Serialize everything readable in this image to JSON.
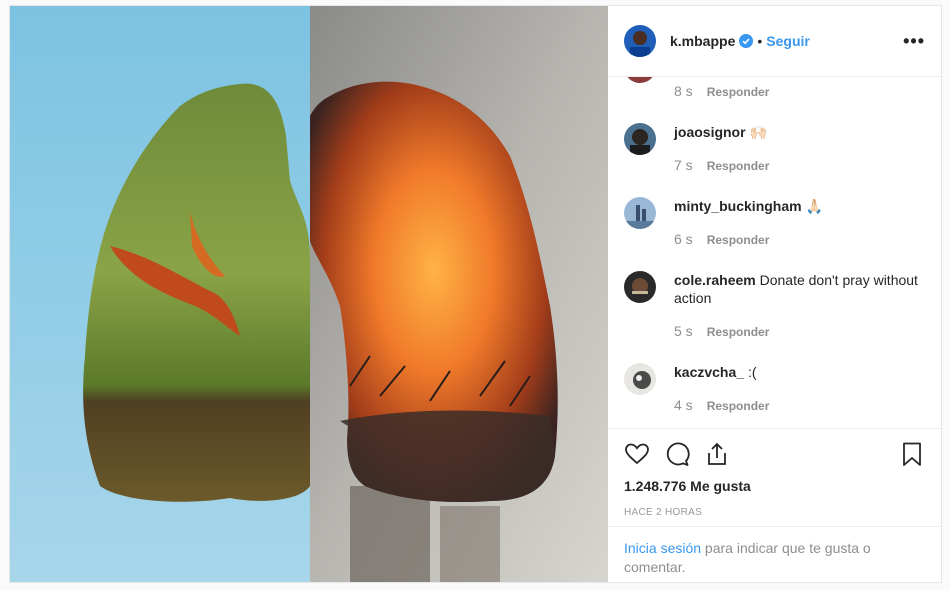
{
  "post": {
    "author": "k.mbappe",
    "follow_label": "Seguir",
    "separator": "•",
    "more_label": "•••"
  },
  "comments": [
    {
      "user": "",
      "text": "",
      "time": "8 s",
      "reply": "Responder"
    },
    {
      "user": "joaosignor",
      "text": "🙌🏻",
      "time": "7 s",
      "reply": "Responder"
    },
    {
      "user": "minty_buckingham",
      "text": "🙏🏻",
      "time": "6 s",
      "reply": "Responder"
    },
    {
      "user": "cole.raheem",
      "text": "Donate don't pray without action",
      "time": "5 s",
      "reply": "Responder"
    },
    {
      "user": "kaczvcha_",
      "text": ":(",
      "time": "4 s",
      "reply": "Responder"
    }
  ],
  "likes": "1.248.776 Me gusta",
  "posted_ago": "HACE 2 HORAS",
  "login": {
    "link": "Inicia sesión",
    "rest": " para indicar que te gusta o comentar."
  },
  "colors": {
    "accent": "#3897f0",
    "verified": "#3897f0"
  }
}
